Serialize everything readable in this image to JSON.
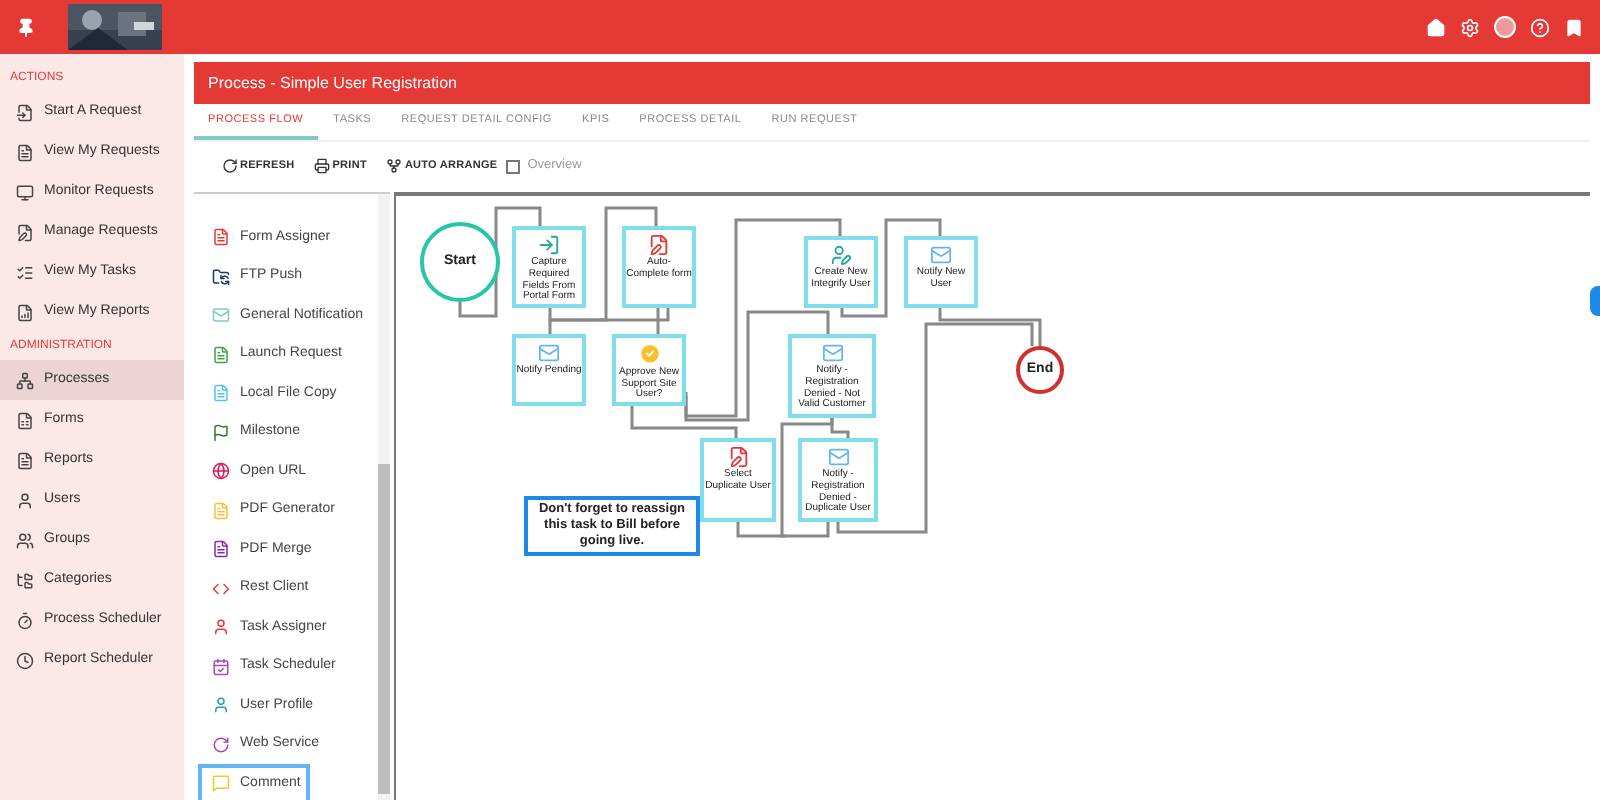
{
  "sidebar": {
    "sections": [
      {
        "heading": "ACTIONS",
        "items": [
          {
            "label": "Start A Request",
            "selected": false
          },
          {
            "label": "View My Requests",
            "selected": false
          },
          {
            "label": "Monitor Requests",
            "selected": false
          },
          {
            "label": "Manage Requests",
            "selected": false
          },
          {
            "label": "View My Tasks",
            "selected": false
          },
          {
            "label": "View My Reports",
            "selected": false
          }
        ]
      },
      {
        "heading": "ADMINISTRATION",
        "items": [
          {
            "label": "Processes",
            "selected": true
          },
          {
            "label": "Forms",
            "selected": false
          },
          {
            "label": "Reports",
            "selected": false
          },
          {
            "label": "Users",
            "selected": false
          },
          {
            "label": "Groups",
            "selected": false
          },
          {
            "label": "Categories",
            "selected": false
          },
          {
            "label": "Process Scheduler",
            "selected": false
          },
          {
            "label": "Report Scheduler",
            "selected": false
          }
        ]
      }
    ]
  },
  "panel": {
    "title": "Process - Simple User Registration",
    "tabs": [
      {
        "label": "PROCESS FLOW",
        "selected": true
      },
      {
        "label": "TASKS",
        "selected": false
      },
      {
        "label": "REQUEST DETAIL CONFIG",
        "selected": false
      },
      {
        "label": "KPIS",
        "selected": false
      },
      {
        "label": "PROCESS DETAIL",
        "selected": false
      },
      {
        "label": "RUN REQUEST",
        "selected": false
      }
    ],
    "toolbar": [
      {
        "label": "REFRESH"
      },
      {
        "label": "PRINT"
      },
      {
        "label": "AUTO ARRANGE"
      }
    ],
    "overview": {
      "label": "Overview",
      "checked": false
    }
  },
  "palette": [
    {
      "label": "Form Assigner",
      "selected": false
    },
    {
      "label": "FTP Push",
      "selected": false
    },
    {
      "label": "General Notification",
      "selected": false
    },
    {
      "label": "Launch Request",
      "selected": false
    },
    {
      "label": "Local File Copy",
      "selected": false
    },
    {
      "label": "Milestone",
      "selected": false
    },
    {
      "label": "Open URL",
      "selected": false
    },
    {
      "label": "PDF Generator",
      "selected": false
    },
    {
      "label": "PDF Merge",
      "selected": false
    },
    {
      "label": "Rest Client",
      "selected": false
    },
    {
      "label": "Task Assigner",
      "selected": false
    },
    {
      "label": "Task Scheduler",
      "selected": false
    },
    {
      "label": "User Profile",
      "selected": false
    },
    {
      "label": "Web Service",
      "selected": false
    },
    {
      "label": "Comment",
      "selected": true
    }
  ],
  "diagram": {
    "nodes": [
      {
        "kind": "start",
        "label": "Start"
      },
      {
        "kind": "import",
        "label": "Capture Required Fields From Portal Form"
      },
      {
        "kind": "form",
        "label": "Auto-Complete form"
      },
      {
        "kind": "email",
        "label": "Notify Pending"
      },
      {
        "kind": "approval",
        "label": "Approve New Support Site User?"
      },
      {
        "kind": "user",
        "label": "Create New Integrify User"
      },
      {
        "kind": "email",
        "label": "Notify New User"
      },
      {
        "kind": "email",
        "label": "Notify - Registration Denied - Not Valid Customer"
      },
      {
        "kind": "form",
        "label": "Select Duplicate User"
      },
      {
        "kind": "email",
        "label": "Notify - Registration Denied - Duplicate User"
      },
      {
        "kind": "end",
        "label": "End"
      },
      {
        "kind": "comment",
        "label": "Don't forget to reassign this task to Bill before going live."
      }
    ]
  }
}
